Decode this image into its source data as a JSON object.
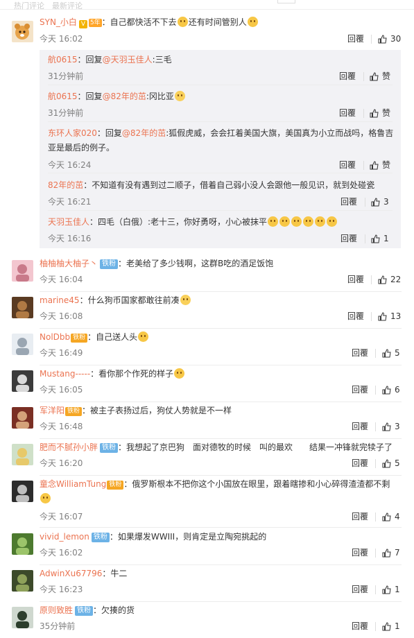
{
  "top_tabs": [
    "热门评论",
    "最新评论"
  ],
  "reply_label": "回覆",
  "main": {
    "user": "SYN_小白",
    "text_a": "：自己都快活不下去",
    "text_b": "还有时间管别人",
    "time": "今天 16:02",
    "likes": "30",
    "yearbadge": "5年"
  },
  "subs": [
    {
      "user": "航0615",
      "pre": "：回复",
      "at": "@天羽玉佳人",
      "post": ":三毛",
      "time": "31分钟前",
      "likes": "赞"
    },
    {
      "user": "航0615",
      "pre": "：回复",
      "at": "@82年的茁",
      "post": ":冈比亚",
      "time": "31分钟前",
      "likes": "赞"
    },
    {
      "user": "东环人家020",
      "pre": "：回复",
      "at": "@82年的茁",
      "post": ":狐假虎威，会会扛着美国大旗，美国真为小立而战吗，格鲁吉",
      "line2": "亚是最后的例子。",
      "time": "今天 16:24",
      "likes": "赞"
    },
    {
      "user": "82年的茁",
      "pre": "：不知道有没有遇到过二顺子，借着自己弱小没人会跟他一般见识，就到处碰瓷",
      "time": "今天 16:21",
      "likes": "3"
    },
    {
      "user": "天羽玉佳人",
      "pre": "：四毛（白俄）:老十三，你好勇呀，小心被抹平",
      "time": "今天 16:16",
      "likes": "1"
    }
  ],
  "comments": [
    {
      "user": "柚柚柚大柚子丶",
      "badge": "铁粉",
      "text": "：老美给了多少钱啊，这群B吃的酒足饭饱",
      "time": "今天 16:04",
      "likes": "22"
    },
    {
      "user": "marine45",
      "text": "：什么狗币国家都敢往前凑",
      "time": "今天 16:08",
      "likes": "13"
    },
    {
      "user": "NolDbb",
      "badge": "铁粉",
      "text": "：自己送人头",
      "time": "今天 16:49",
      "likes": "5"
    },
    {
      "user": "Mustang-----",
      "text": "：看你那个作死的样子",
      "time": "今天 16:05",
      "likes": "6"
    },
    {
      "user": "军洋阳",
      "badge": "铁粉",
      "text": "：被主子表扬过后，狗仗人势就是不一样",
      "time": "今天 16:48",
      "likes": "3"
    },
    {
      "user": "肥而不腻孙小胖",
      "badge": "铁粉",
      "text": "：我想起了京巴狗　面对德牧的时候　叫的最欢　　结果一冲锋就完犊子了",
      "time": "今天 16:20",
      "likes": "5"
    },
    {
      "user": "童念WilliamTung",
      "badge": "铁粉",
      "text": "：俄罗斯根本不把你这个小国放在眼里，跟着瞎掺和小心碎得渣渣都不剩",
      "time": "今天 16:07",
      "likes": "4"
    },
    {
      "user": "vivid_lemon",
      "badge": "铁粉",
      "text": "：如果爆发WWIII，则肯定是立陶宛挑起的",
      "time": "今天 16:02",
      "likes": "7"
    },
    {
      "user": "AdwinXu67796",
      "text": "：牛二",
      "time": "今天 16:23",
      "likes": "1"
    },
    {
      "user": "原则致胜",
      "badge": "铁粉",
      "text": "：欠揍的货",
      "time": "35分钟前",
      "likes": "1"
    }
  ]
}
